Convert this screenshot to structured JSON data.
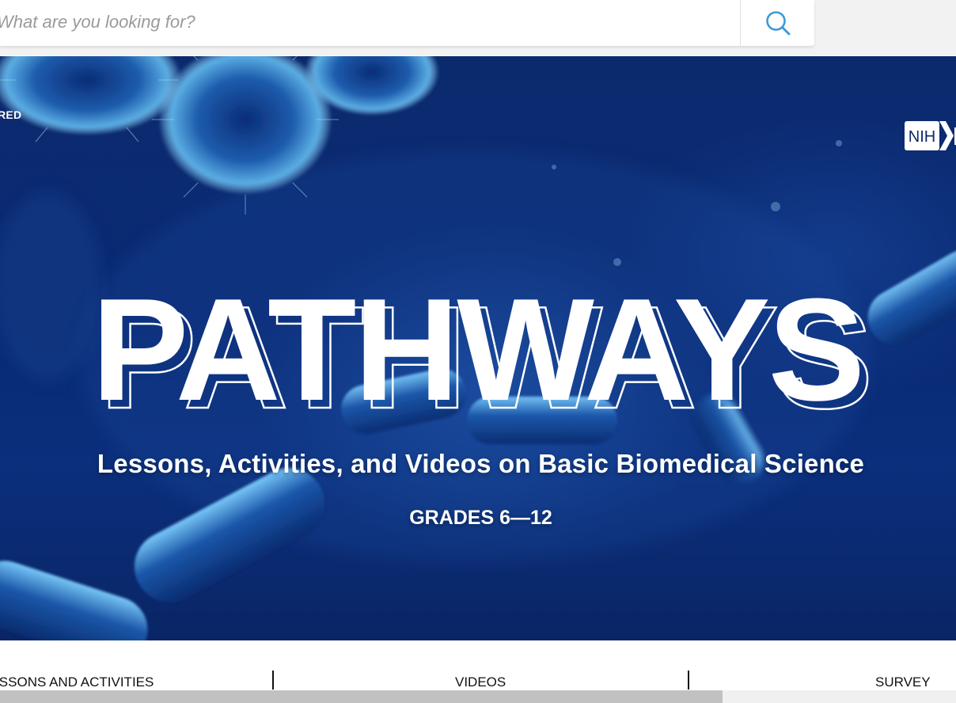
{
  "search": {
    "placeholder": "What are you looking for?",
    "button_icon": "search-icon"
  },
  "hero": {
    "sponsor_text": "ORED",
    "logo_text": "NIH",
    "title": "PATHWAYS",
    "subtitle": "Lessons, Activities, and Videos on Basic Biomedical Science",
    "grades": "GRADES 6—12"
  },
  "nav": {
    "items": [
      {
        "label": "LESSONS AND ACTIVITIES"
      },
      {
        "label": "VIDEOS"
      },
      {
        "label": "SURVEY"
      }
    ]
  },
  "scrollbar": {
    "position_fraction": 0
  },
  "colors": {
    "hero_background": "#0a2a74",
    "search_icon": "#3c9ad8",
    "text_white": "#ffffff"
  }
}
